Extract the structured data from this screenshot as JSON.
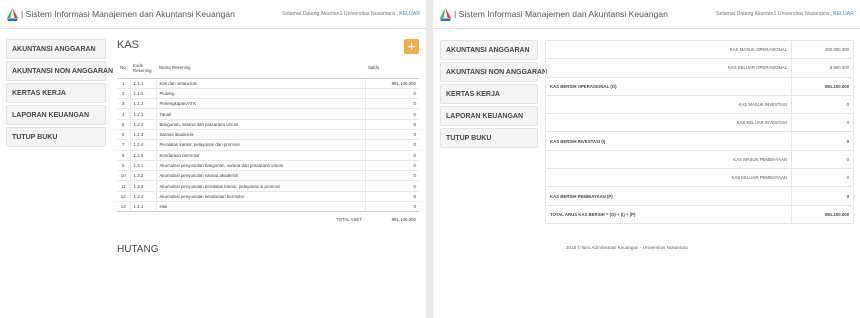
{
  "app": {
    "brand": "| Sistem Informasi Manajemen dan Akuntansi Keuangan",
    "greeting": "Selamat Datang Akuntan1 Universitas Nusantara ,",
    "logout": "KELUAR"
  },
  "sidebar": {
    "items": [
      {
        "label": "AKUNTANSI ANGGARAN"
      },
      {
        "label": "AKUNTANSI NON ANGGARAN"
      },
      {
        "label": "KERTAS KERJA"
      },
      {
        "label": "LAPORAN KEUANGAN"
      },
      {
        "label": "TUTUP BUKU"
      }
    ]
  },
  "kas": {
    "title": "KAS",
    "add_icon": "plus-icon",
    "headers": {
      "no": "No",
      "kode": "Kode Rekening",
      "nama": "Nama Rekening",
      "saldo": "Saldo"
    },
    "rows": [
      {
        "no": "1",
        "kode": "1.1.1",
        "nama": "Kas dan setara kas",
        "saldo": "891.100.000"
      },
      {
        "no": "2",
        "kode": "1.1.2",
        "nama": "Piutang",
        "saldo": "0"
      },
      {
        "no": "3",
        "kode": "1.1.3",
        "nama": "Perlengkapan/ATK",
        "saldo": "0"
      },
      {
        "no": "4",
        "kode": "1.2.1",
        "nama": "Tanah",
        "saldo": "0"
      },
      {
        "no": "5",
        "kode": "1.2.2",
        "nama": "Bangunan, sarana dan prasarana umum",
        "saldo": "0"
      },
      {
        "no": "6",
        "kode": "1.2.3",
        "nama": "Sarana akademik",
        "saldo": "0"
      },
      {
        "no": "7",
        "kode": "1.2.4",
        "nama": "Peralatan kantor, pelayanan dan promosi",
        "saldo": "0"
      },
      {
        "no": "8",
        "kode": "1.2.5",
        "nama": "Kendaraan bermotor",
        "saldo": "0"
      },
      {
        "no": "9",
        "kode": "1.3.1",
        "nama": "Akumulasi penyusutan bangunan, sarana dan prasarana umum",
        "saldo": "0"
      },
      {
        "no": "10",
        "kode": "1.3.2",
        "nama": "Akumulasi penyusutan sarana akademik",
        "saldo": "0"
      },
      {
        "no": "11",
        "kode": "1.3.3",
        "nama": "Akumulasi penyusutan peralatan kantor, pelayanan & promosi",
        "saldo": "0"
      },
      {
        "no": "12",
        "kode": "1.3.4",
        "nama": "Akumulasi penyusutan kendaraan bermotor",
        "saldo": "0"
      },
      {
        "no": "13",
        "kode": "1.4.1",
        "nama": "Hak",
        "saldo": "0"
      }
    ],
    "total_label": "TOTAL ASET",
    "total_value": "891.100.000"
  },
  "hutang": {
    "title": "HUTANG"
  },
  "cashflow": {
    "rows": [
      {
        "label": "KAS MASUK OPERASIONAL",
        "value": "900.000.000",
        "sum": false
      },
      {
        "label": "KAS KELUAR OPERASIONAL",
        "value": "8.900.000",
        "sum": false
      },
      {
        "label": "KAS BERSIH OPERASIONAL (O)",
        "value": "891.100.000",
        "sum": true
      },
      {
        "label": "KAS MASUK INVESTASI",
        "value": "0",
        "sum": false
      },
      {
        "label": "KAS KELUAR INVESTASI",
        "value": "0",
        "sum": false
      },
      {
        "label": "KAS BERSIH INVESTASI (I)",
        "value": "0",
        "sum": true
      },
      {
        "label": "KAS MASUK PEMBIAYAAN",
        "value": "0",
        "sum": false
      },
      {
        "label": "KAS KELUAR PEMBIAYAAN",
        "value": "0",
        "sum": false
      },
      {
        "label": "KAS BERSIH PEMBIAYAAN (P)",
        "value": "0",
        "sum": true
      },
      {
        "label": "TOTAL ARUS KAS BERSIH = (O) + (I) + (P)",
        "value": "891.100.000",
        "sum": true
      }
    ]
  },
  "footer": {
    "text": "2016 © Biro Administrasi Keuangan - Universitas Nusantara"
  },
  "colors": {
    "accent": "#f0ad4e",
    "link": "#3a87c8",
    "logo_red": "#e0403a",
    "logo_green": "#4caf50",
    "logo_blue": "#2f6fbf"
  }
}
